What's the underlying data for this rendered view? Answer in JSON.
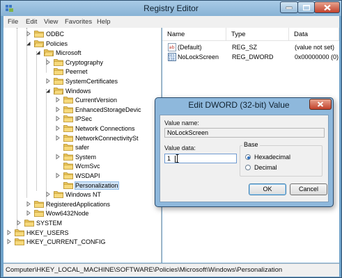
{
  "window": {
    "title": "Registry Editor",
    "menu": [
      "File",
      "Edit",
      "View",
      "Favorites",
      "Help"
    ]
  },
  "tree": [
    {
      "label": "ODBC",
      "expanded": false,
      "selected": false
    },
    {
      "label": "Policies",
      "expanded": true,
      "selected": false
    },
    {
      "label": "Microsoft",
      "expanded": true,
      "selected": false
    },
    {
      "label": "Cryptography",
      "expanded": false,
      "selected": false
    },
    {
      "label": "Peernet",
      "expanded": false,
      "selected": false
    },
    {
      "label": "SystemCertificates",
      "expanded": false,
      "selected": false
    },
    {
      "label": "Windows",
      "expanded": true,
      "selected": false
    },
    {
      "label": "CurrentVersion",
      "expanded": false,
      "selected": false
    },
    {
      "label": "EnhancedStorageDevic",
      "expanded": false,
      "selected": false
    },
    {
      "label": "IPSec",
      "expanded": false,
      "selected": false
    },
    {
      "label": "Network Connections",
      "expanded": false,
      "selected": false
    },
    {
      "label": "NetworkConnectivitySt",
      "expanded": false,
      "selected": false
    },
    {
      "label": "safer",
      "expanded": false,
      "selected": false
    },
    {
      "label": "System",
      "expanded": false,
      "selected": false
    },
    {
      "label": "WcmSvc",
      "expanded": false,
      "selected": false
    },
    {
      "label": "WSDAPI",
      "expanded": false,
      "selected": false
    },
    {
      "label": "Personalization",
      "expanded": false,
      "selected": true
    },
    {
      "label": "Windows NT",
      "expanded": false,
      "selected": false
    },
    {
      "label": "RegisteredApplications",
      "expanded": false,
      "selected": false
    },
    {
      "label": "Wow6432Node",
      "expanded": false,
      "selected": false
    },
    {
      "label": "SYSTEM",
      "expanded": false,
      "selected": false
    },
    {
      "label": "HKEY_USERS",
      "expanded": false,
      "selected": false
    },
    {
      "label": "HKEY_CURRENT_CONFIG",
      "expanded": false,
      "selected": false
    }
  ],
  "list": {
    "columns": [
      "Name",
      "Type",
      "Data"
    ],
    "rows": [
      {
        "name": "(Default)",
        "type": "REG_SZ",
        "data": "(value not set)",
        "icon": "string-value-icon"
      },
      {
        "name": "NoLockScreen",
        "type": "REG_DWORD",
        "data": "0x00000000 (0)",
        "icon": "binary-value-icon"
      }
    ]
  },
  "status_path": "Computer\\HKEY_LOCAL_MACHINE\\SOFTWARE\\Policies\\Microsoft\\Windows\\Personalization",
  "dialog": {
    "title": "Edit DWORD (32-bit) Value",
    "value_name_label": "Value name:",
    "value_name": "NoLockScreen",
    "value_data_label": "Value data:",
    "value_data": "1",
    "base_label": "Base",
    "hex_label": "Hexadecimal",
    "dec_label": "Decimal",
    "base_selected": "Hexadecimal",
    "ok_label": "OK",
    "cancel_label": "Cancel"
  },
  "colors": {
    "titlebar": "#a9cbe6",
    "close_button": "#c2412b",
    "selection": "#cfe3f6",
    "folder": "#e8c35a"
  }
}
